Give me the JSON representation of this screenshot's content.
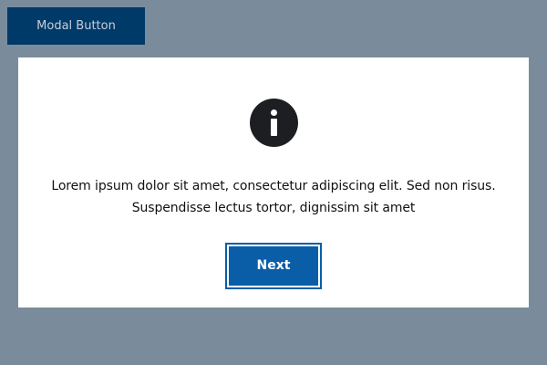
{
  "page": {
    "background": "#7a8c9b"
  },
  "trigger_button": {
    "label": "Modal Button",
    "background": "#003a68"
  },
  "modal": {
    "icon": "info-icon",
    "message_line1": "Lorem ipsum dolor sit amet, consectetur adipiscing elit. Sed non risus.",
    "message_line2": "Suspendisse lectus tortor, dignissim sit amet",
    "next_label": "Next",
    "accent_color": "#0a5ea8"
  }
}
